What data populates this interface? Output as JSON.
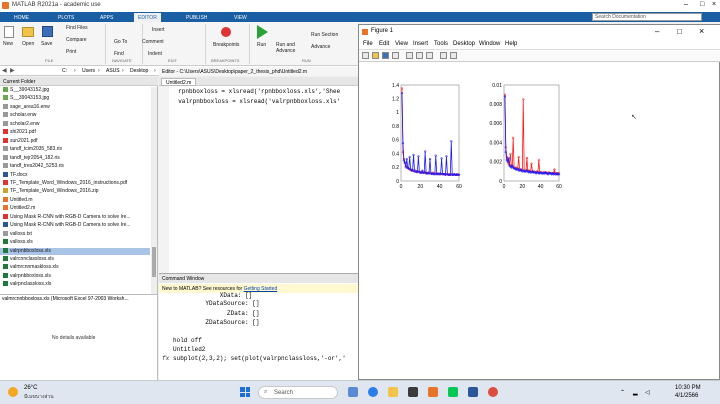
{
  "app": {
    "title": "MATLAB R2021a - academic use"
  },
  "ribbon_tabs": [
    "HOME",
    "PLOTS",
    "APPS",
    "EDITOR",
    "PUBLISH",
    "VIEW"
  ],
  "search": {
    "placeholder": "Search Documentation"
  },
  "ribbon": {
    "new": "New",
    "open": "Open",
    "save": "Save",
    "find_files": "Find Files",
    "compare": "Compare",
    "print": "Print",
    "insert": "Insert",
    "comment": "Comment",
    "indent": "Indent",
    "go_to": "Go To",
    "find": "Find",
    "breakpoints": "Breakpoints",
    "run": "Run",
    "run_advance": "Run and Advance",
    "run_section": "Run Section",
    "advance": "Advance",
    "groups": {
      "file": "FILE",
      "navigate": "NAVIGATE",
      "edit": "EDIT",
      "breakpoints": "BREAKPOINTS",
      "run": "RUN"
    }
  },
  "address": {
    "path": [
      "C:",
      "Users",
      "ASUS",
      "Desktop",
      "paper_2_thesis_phd"
    ]
  },
  "current_folder": {
    "header": "Current Folder",
    "files": [
      {
        "name": "S__39043152.jpg",
        "type": "img"
      },
      {
        "name": "S__39043153.jpg",
        "type": "img"
      },
      {
        "name": "sage_area16.enw",
        "type": "txt"
      },
      {
        "name": "scholar.enw",
        "type": "txt"
      },
      {
        "name": "scholar2.enw",
        "type": "txt"
      },
      {
        "name": "shi2021.pdf",
        "type": "pdf"
      },
      {
        "name": "sun2021.pdf",
        "type": "pdf"
      },
      {
        "name": "tandf_tcim2035_583.ris",
        "type": "txt"
      },
      {
        "name": "tandf_tejr2054_182.ris",
        "type": "txt"
      },
      {
        "name": "tandf_tres2042_5253.ris",
        "type": "txt"
      },
      {
        "name": "TF.docx",
        "type": "doc"
      },
      {
        "name": "TF_Template_Word_Windows_2016_instructions.pdf",
        "type": "pdf"
      },
      {
        "name": "TF_Template_Word_Windows_2016.zip",
        "type": "zip"
      },
      {
        "name": "Untitled.m",
        "type": "m"
      },
      {
        "name": "Untitled2.m",
        "type": "m"
      },
      {
        "name": "Using Mask R-CNN with RGB-D Camera to solve Ire...",
        "type": "pdf"
      },
      {
        "name": "Using Mask R-CNN with RGB-D Camera to solve Ire...",
        "type": "doc"
      },
      {
        "name": "valloss.txt",
        "type": "txt"
      },
      {
        "name": "valloss.xls",
        "type": "xls"
      },
      {
        "name": "valrpnbboxloss.xls",
        "type": "xls",
        "selected": true
      },
      {
        "name": "valrcnnclassloss.xls",
        "type": "xls"
      },
      {
        "name": "valmrcnnmaskloss.xls",
        "type": "xls"
      },
      {
        "name": "valrpnbboxloss.xls",
        "type": "xls"
      },
      {
        "name": "valrpnclassloss.xls",
        "type": "xls"
      }
    ],
    "details_title": "valmrcnnbboxloss.xls  (Microsoft Excel 97-2003 Worksh...",
    "details_text": "No details available"
  },
  "editor": {
    "tab": "Untitled2.m",
    "path": "Editor - C:\\Users\\ASUS\\Desktop\\paper_2_thesis_phd\\Untitled2.m",
    "lines": [
      "  rpnbboxloss = xlsread('rpnbboxloss.xls','Shee",
      "  valrpnbboxloss = xlsread('valrpnbboxloss.xls'"
    ]
  },
  "command_window": {
    "header": "Command Window",
    "banner_text": "New to MATLAB? See resources for ",
    "banner_link": "Getting Started",
    "lines": [
      "             XData: []",
      "         YDataSource: []",
      "               ZData: []",
      "         ZDataSource: []",
      "",
      "hold off",
      "Untitled2",
      "subplot(2,3,2); set(plot(valrpnclassloss,'-or','"
    ],
    "prompt": "fx"
  },
  "figure": {
    "title": "Figure 1",
    "menu": [
      "File",
      "Edit",
      "View",
      "Insert",
      "Tools",
      "Desktop",
      "Window",
      "Help"
    ]
  },
  "chart_data": [
    {
      "type": "line",
      "title": "",
      "xlabel": "",
      "ylabel": "",
      "xlim": [
        0,
        60
      ],
      "ylim": [
        0,
        1.4
      ],
      "xticks": [
        0,
        20,
        40,
        60
      ],
      "yticks": [
        0,
        0.2,
        0.4,
        0.6,
        0.8,
        1,
        1.2,
        1.4
      ],
      "series": [
        {
          "color": "#ff1a1a",
          "marker": "o",
          "values": [
            1.35,
            0.42,
            0.32,
            0.26,
            0.22,
            0.2,
            0.19,
            0.18,
            0.17,
            0.16,
            0.16,
            0.15,
            0.15,
            0.14,
            0.15,
            0.14,
            0.13,
            0.14,
            0.13,
            0.13,
            0.12,
            0.13,
            0.12,
            0.12,
            0.13,
            0.12,
            0.11,
            0.12,
            0.11,
            0.12,
            0.11,
            0.11,
            0.12,
            0.11,
            0.1,
            0.11,
            0.1,
            0.11,
            0.1,
            0.1,
            0.11,
            0.1,
            0.1,
            0.1,
            0.1,
            0.09,
            0.1,
            0.1,
            0.09,
            0.1,
            0.09,
            0.1,
            0.09,
            0.09,
            0.1,
            0.09,
            0.09,
            0.09,
            0.09,
            0.09
          ]
        },
        {
          "color": "#1a1aff",
          "marker": "o",
          "values": [
            1.28,
            0.55,
            0.3,
            0.27,
            0.2,
            0.32,
            0.19,
            0.18,
            0.35,
            0.17,
            0.15,
            0.16,
            0.38,
            0.14,
            0.14,
            0.13,
            0.14,
            0.36,
            0.13,
            0.12,
            0.12,
            0.15,
            0.12,
            0.12,
            0.43,
            0.11,
            0.11,
            0.12,
            0.11,
            0.32,
            0.11,
            0.1,
            0.11,
            0.1,
            0.1,
            0.37,
            0.1,
            0.1,
            0.11,
            0.1,
            0.1,
            0.33,
            0.1,
            0.1,
            0.1,
            0.09,
            0.36,
            0.1,
            0.09,
            0.09,
            0.09,
            0.58,
            0.09,
            0.09,
            0.1,
            0.09,
            0.09,
            0.1,
            0.09,
            0.09
          ]
        }
      ]
    },
    {
      "type": "line",
      "title": "",
      "xlabel": "",
      "ylabel": "",
      "xlim": [
        0,
        60
      ],
      "ylim": [
        0,
        0.01
      ],
      "xticks": [
        0,
        20,
        40,
        60
      ],
      "yticks": [
        0,
        0.002,
        0.004,
        0.006,
        0.008,
        0.01
      ],
      "series": [
        {
          "color": "#ff1a1a",
          "marker": "o",
          "values": [
            0.009,
            0.0035,
            0.0025,
            0.0022,
            0.0018,
            0.0017,
            0.0028,
            0.0016,
            0.0015,
            0.0045,
            0.0014,
            0.0013,
            0.0014,
            0.0012,
            0.0013,
            0.0025,
            0.0012,
            0.0011,
            0.0012,
            0.0011,
            0.0085,
            0.0011,
            0.001,
            0.0011,
            0.0024,
            0.001,
            0.0011,
            0.001,
            0.001,
            0.0018,
            0.001,
            0.0009,
            0.001,
            0.0009,
            0.0009,
            0.001,
            0.0009,
            0.0022,
            0.0009,
            0.0009,
            0.0009,
            0.0008,
            0.0009,
            0.0009,
            0.0008,
            0.0009,
            0.0008,
            0.0008,
            0.0009,
            0.0008,
            0.0008,
            0.0008,
            0.0008,
            0.0008,
            0.0012,
            0.0008,
            0.0008,
            0.0007,
            0.0008,
            0.0008
          ]
        },
        {
          "color": "#1a1aff",
          "marker": "o",
          "values": [
            0.0088,
            0.003,
            0.0022,
            0.002,
            0.0024,
            0.0016,
            0.0015,
            0.0014,
            0.0016,
            0.0014,
            0.0013,
            0.0013,
            0.0012,
            0.0012,
            0.0013,
            0.0011,
            0.0011,
            0.0012,
            0.0011,
            0.001,
            0.0011,
            0.001,
            0.001,
            0.001,
            0.0011,
            0.001,
            0.0009,
            0.001,
            0.0009,
            0.0009,
            0.001,
            0.0009,
            0.0009,
            0.0009,
            0.0008,
            0.0009,
            0.0009,
            0.0008,
            0.0008,
            0.0009,
            0.0008,
            0.0008,
            0.0008,
            0.0008,
            0.0009,
            0.0008,
            0.0008,
            0.0007,
            0.0008,
            0.0008,
            0.0008,
            0.0007,
            0.0008,
            0.0007,
            0.0008,
            0.0007,
            0.0007,
            0.0008,
            0.0007,
            0.0007
          ]
        }
      ]
    }
  ],
  "taskbar": {
    "weather_temp": "26°C",
    "weather_desc": "มีเมฆบางส่วน",
    "search": "Search",
    "time": "10:30 PM",
    "date": "4/1/2566"
  }
}
